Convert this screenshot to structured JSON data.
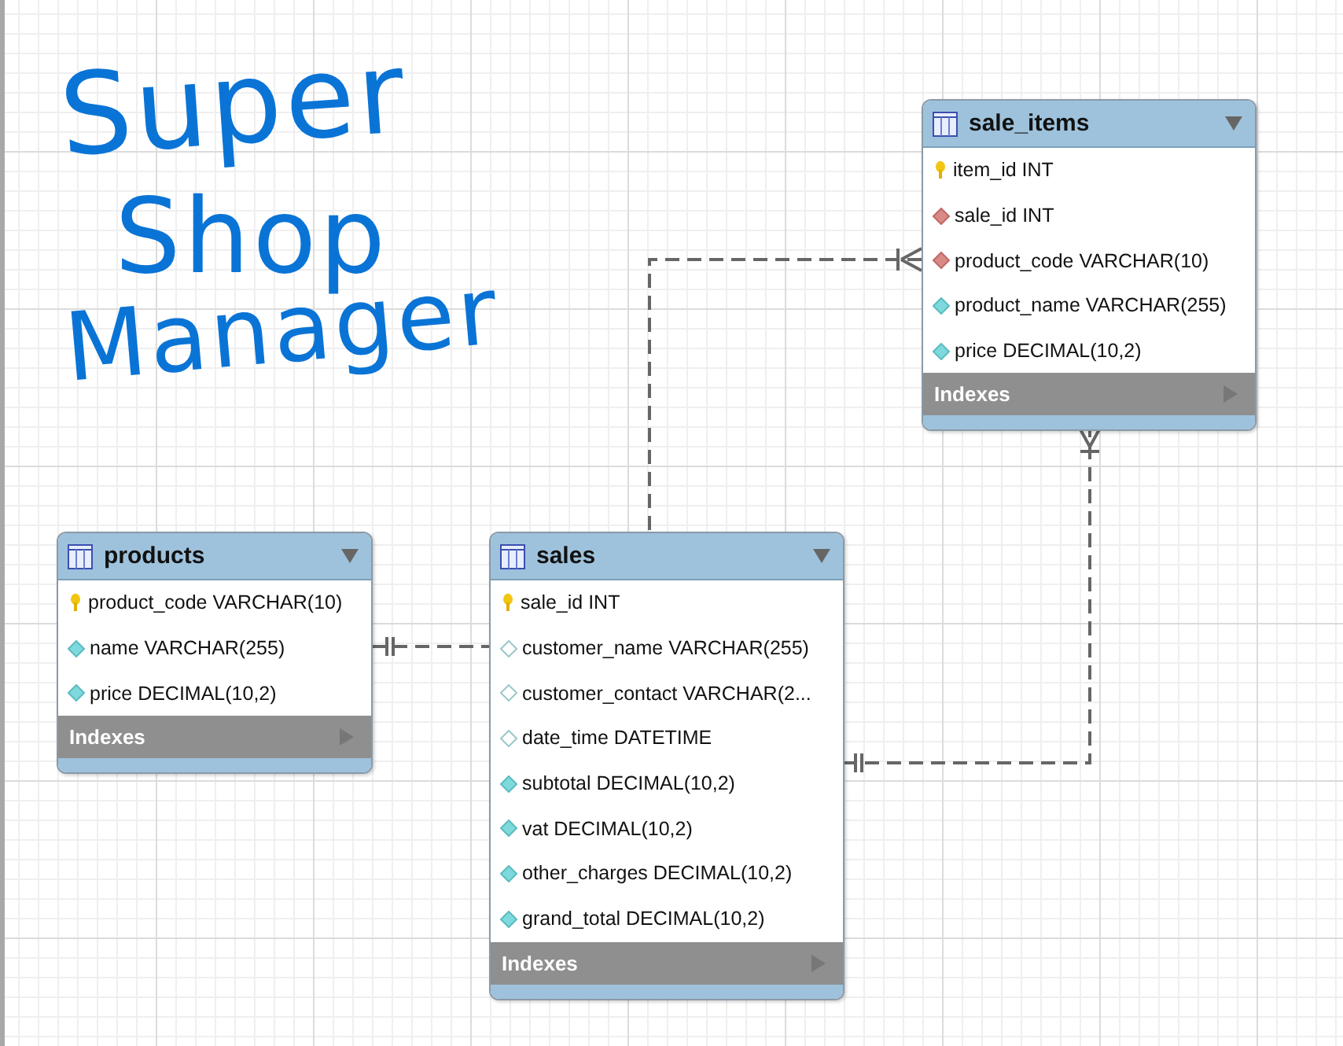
{
  "handwritten_title": [
    "Super",
    "Shop",
    "Manager"
  ],
  "tables": [
    {
      "name": "sale_items",
      "indexes_label": "Indexes",
      "indexes_expanded": false,
      "columns": [
        {
          "kind": "primary",
          "text": "item_id INT"
        },
        {
          "kind": "foreign",
          "text": "sale_id INT"
        },
        {
          "kind": "foreign",
          "text": "product_code VARCHAR(10)"
        },
        {
          "kind": "notnull",
          "text": "product_name VARCHAR(255)"
        },
        {
          "kind": "notnull",
          "text": "price DECIMAL(10,2)"
        }
      ]
    },
    {
      "name": "products",
      "indexes_label": "Indexes",
      "indexes_expanded": false,
      "columns": [
        {
          "kind": "primary",
          "text": "product_code VARCHAR(10)"
        },
        {
          "kind": "notnull",
          "text": "name VARCHAR(255)"
        },
        {
          "kind": "notnull",
          "text": "price DECIMAL(10,2)"
        }
      ]
    },
    {
      "name": "sales",
      "indexes_label": "Indexes",
      "indexes_expanded": false,
      "columns": [
        {
          "kind": "primary",
          "text": "sale_id INT"
        },
        {
          "kind": "nullable",
          "text": "customer_name VARCHAR(255)"
        },
        {
          "kind": "nullable",
          "text": "customer_contact VARCHAR(2..."
        },
        {
          "kind": "nullable",
          "text": "date_time DATETIME"
        },
        {
          "kind": "notnull",
          "text": "subtotal DECIMAL(10,2)"
        },
        {
          "kind": "notnull",
          "text": "vat DECIMAL(10,2)"
        },
        {
          "kind": "notnull",
          "text": "other_charges DECIMAL(10,2)"
        },
        {
          "kind": "notnull",
          "text": "grand_total DECIMAL(10,2)"
        }
      ]
    }
  ]
}
